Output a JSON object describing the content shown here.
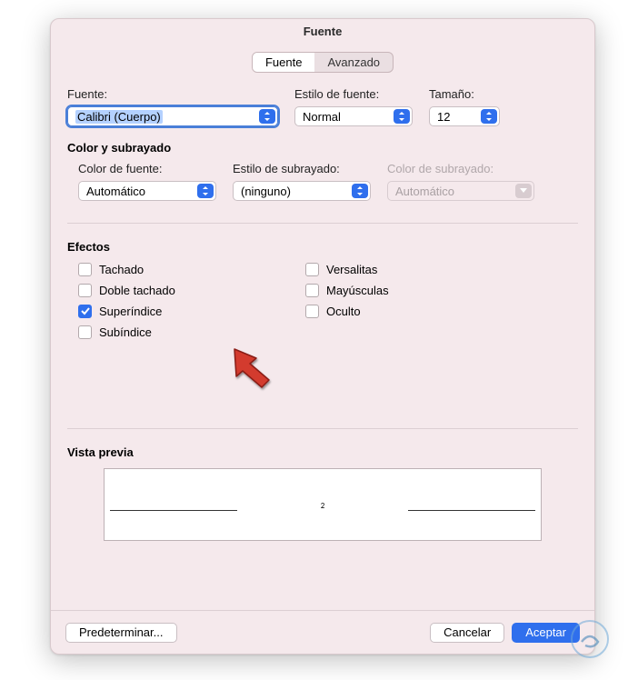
{
  "window": {
    "title": "Fuente"
  },
  "tabs": {
    "font": "Fuente",
    "advanced": "Avanzado"
  },
  "font_section": {
    "font_label": "Fuente:",
    "font_value": "Calibri (Cuerpo)",
    "style_label": "Estilo de fuente:",
    "style_value": "Normal",
    "size_label": "Tamaño:",
    "size_value": "12"
  },
  "color_section": {
    "title": "Color y subrayado",
    "font_color_label": "Color de fuente:",
    "font_color_value": "Automático",
    "underline_style_label": "Estilo de subrayado:",
    "underline_style_value": "(ninguno)",
    "underline_color_label": "Color de subrayado:",
    "underline_color_value": "Automático"
  },
  "effects": {
    "title": "Efectos",
    "items": {
      "strike": "Tachado",
      "dstrike": "Doble tachado",
      "superscript": "Superíndice",
      "subscript": "Subíndice",
      "smallcaps": "Versalitas",
      "allcaps": "Mayúsculas",
      "hidden": "Oculto"
    },
    "checked": {
      "superscript": true
    }
  },
  "preview": {
    "title": "Vista previa",
    "sample": "2"
  },
  "footer": {
    "default_btn": "Predeterminar...",
    "cancel_btn": "Cancelar",
    "ok_btn": "Aceptar"
  },
  "annotation": {
    "arrow_color": "#d33b2e"
  }
}
